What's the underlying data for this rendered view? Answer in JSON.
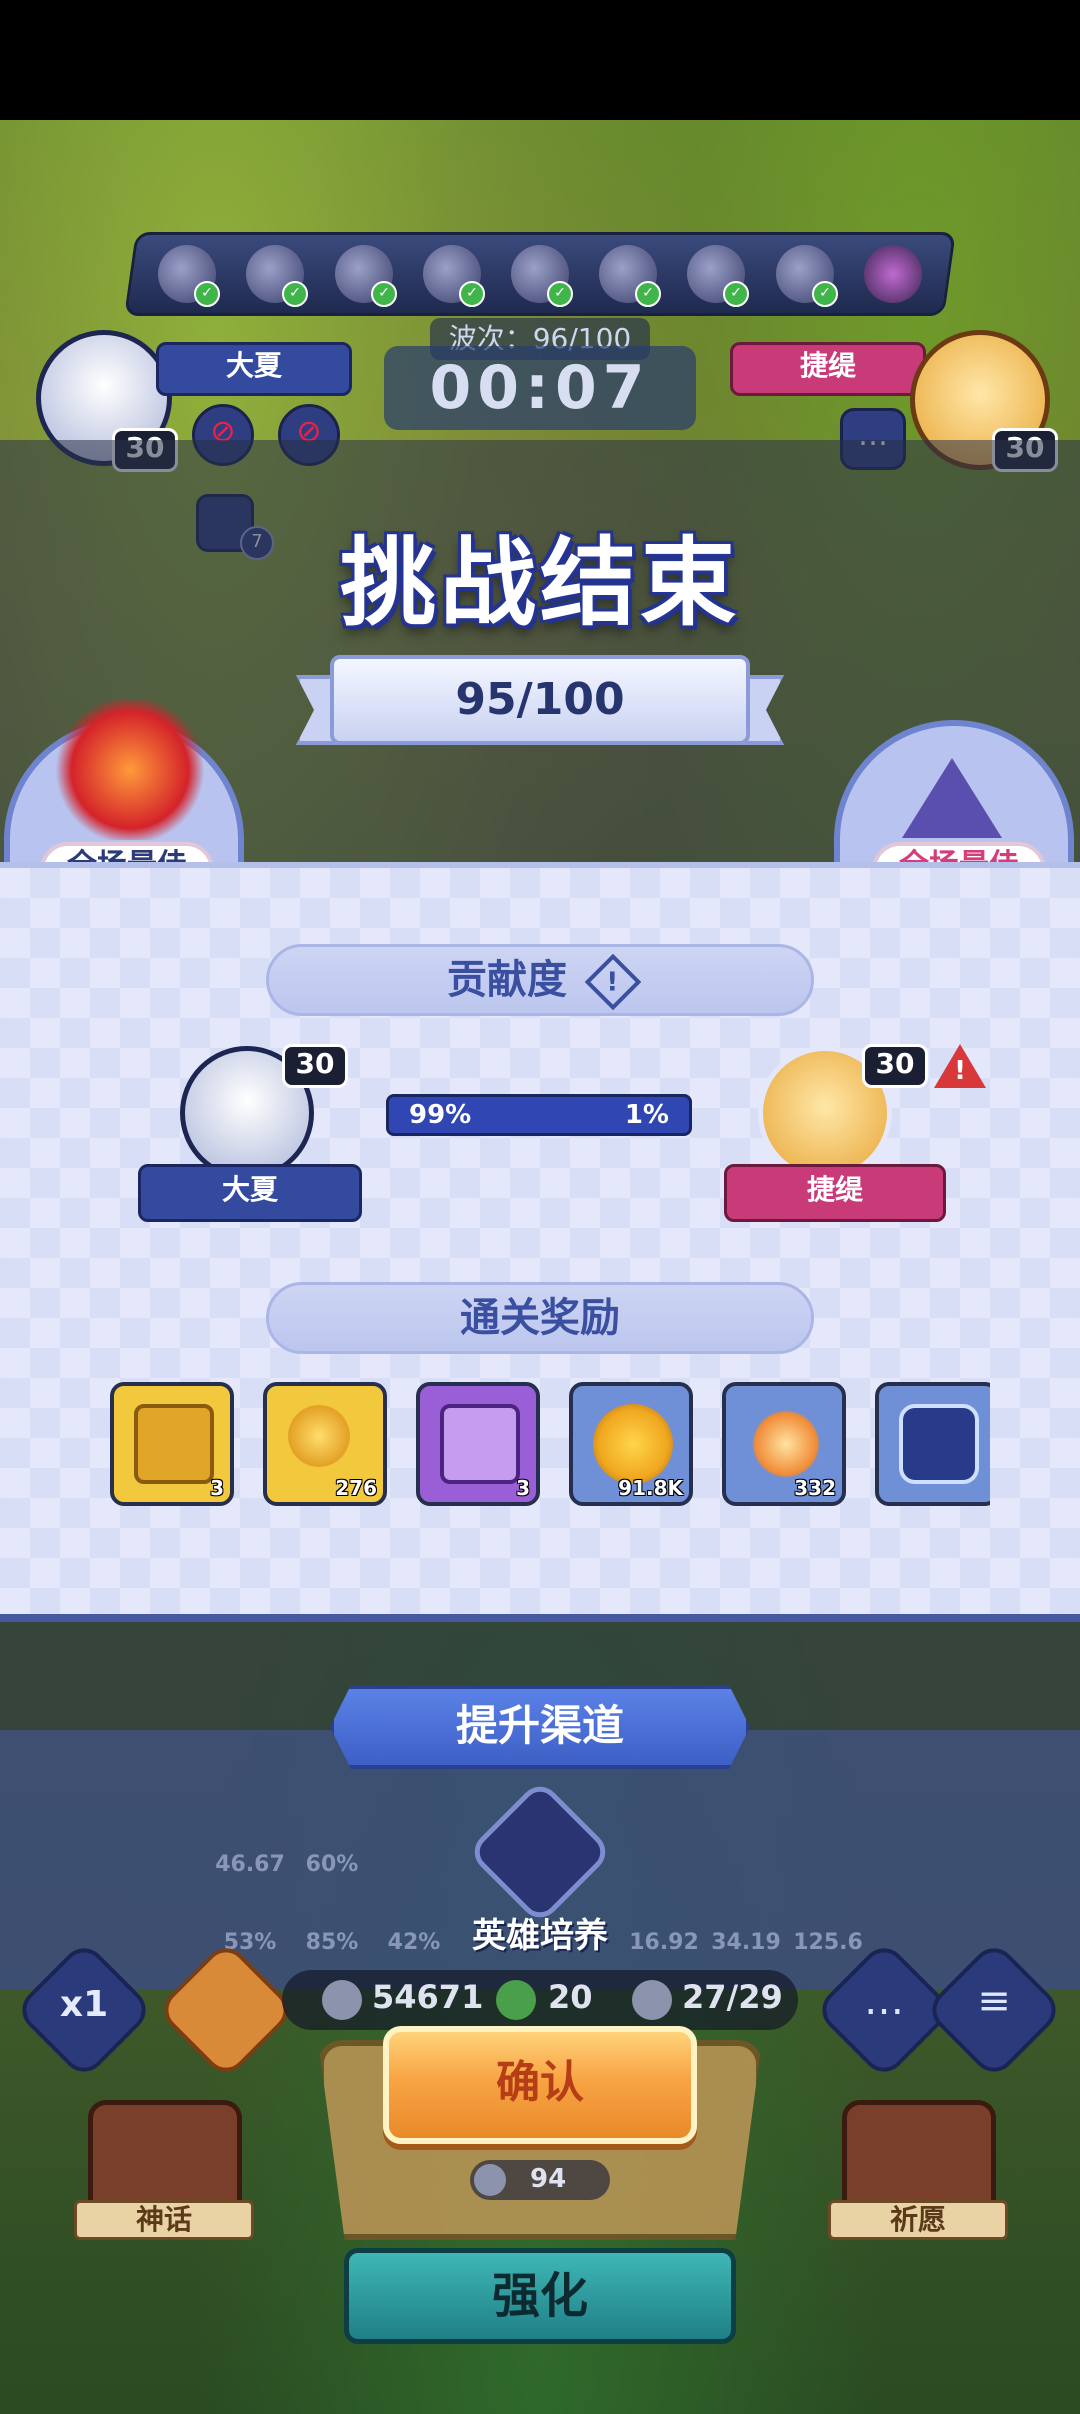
{
  "top_bar": {
    "wave_text": "波次：96/100",
    "timer": "00:07"
  },
  "players": {
    "left": {
      "name": "大夏",
      "level": "30"
    },
    "right": {
      "name": "捷缇",
      "level": "30"
    }
  },
  "indicators": {
    "note_count": "7"
  },
  "result": {
    "title": "挑战结束",
    "wave_progress": "95/100",
    "mvp_label_left": "全场最佳",
    "mvp_label_right": "全场最佳",
    "contribution_title": "贡献度",
    "contribution_left_pct": "99%",
    "contribution_right_pct": "1%",
    "contribution_left_fraction": 0.99,
    "rewards_title": "通关奖励",
    "rewards": [
      {
        "icon": "gold-chest-icon",
        "count": "3",
        "color": "#f2c93c"
      },
      {
        "icon": "gold-key-icon",
        "count": "276",
        "color": "#f2c93c"
      },
      {
        "icon": "purple-chest-icon",
        "count": "3",
        "color": "#9a5fd6"
      },
      {
        "icon": "gold-coin-icon",
        "count": "91.8K",
        "color": "#6f8fd6"
      },
      {
        "icon": "trophy-medal-icon",
        "count": "332",
        "color": "#6f8fd6"
      },
      {
        "icon": "crystal-emblem-icon",
        "count": "",
        "color": "#6f8fd6"
      }
    ]
  },
  "channel": {
    "title": "提升渠道",
    "item_label": "英雄培养"
  },
  "ghost_stats": [
    "46.67",
    "60%",
    "53%",
    "85%",
    "42%",
    "16.92",
    "34.19",
    "125.6"
  ],
  "resources": {
    "silver": "54671",
    "clover": "20",
    "units": "27/29"
  },
  "buttons": {
    "speed": "x1",
    "confirm": "确认",
    "cost": "94",
    "enhance": "强化",
    "myth": "神话",
    "wish": "祈愿"
  },
  "colors": {
    "accent_blue": "#334a9e",
    "accent_pink": "#c93a78",
    "confirm_orange": "#f8a444"
  }
}
